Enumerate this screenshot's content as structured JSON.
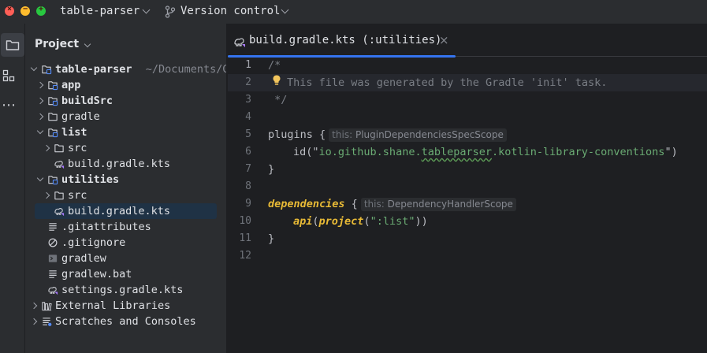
{
  "titlebar": {
    "project_name": "table-parser",
    "vcs_label": "Version control",
    "traffic_lights": {
      "close": "×",
      "minimize": "−",
      "maximize": "+"
    }
  },
  "toolstrip": {
    "items": [
      {
        "name": "project-tool-icon",
        "active": true
      },
      {
        "name": "structure-tool-icon",
        "active": false
      },
      {
        "name": "more-tools-icon",
        "active": false
      }
    ],
    "more_label": "⋯"
  },
  "project_panel": {
    "title": "Project",
    "tree": [
      {
        "label": "table-parser",
        "hint": "~/Documents/G",
        "depth": 0,
        "expanded": true,
        "icon": "module-folder",
        "bold": true
      },
      {
        "label": "app",
        "depth": 1,
        "expanded": false,
        "icon": "module-folder",
        "bold": true
      },
      {
        "label": "buildSrc",
        "depth": 1,
        "expanded": false,
        "icon": "module-folder",
        "bold": true
      },
      {
        "label": "gradle",
        "depth": 1,
        "expanded": false,
        "icon": "folder",
        "bold": false
      },
      {
        "label": "list",
        "depth": 1,
        "expanded": true,
        "icon": "module-folder",
        "bold": true
      },
      {
        "label": "src",
        "depth": 2,
        "expanded": false,
        "icon": "folder",
        "bold": false
      },
      {
        "label": "build.gradle.kts",
        "depth": 2,
        "icon": "gradle-kts",
        "bold": false
      },
      {
        "label": "utilities",
        "depth": 1,
        "expanded": true,
        "icon": "module-folder",
        "bold": true
      },
      {
        "label": "src",
        "depth": 2,
        "expanded": false,
        "icon": "folder",
        "bold": false
      },
      {
        "label": "build.gradle.kts",
        "depth": 2,
        "icon": "gradle-kts",
        "bold": false,
        "selected": true
      },
      {
        "label": ".gitattributes",
        "depth": 1,
        "icon": "text-file",
        "bold": false
      },
      {
        "label": ".gitignore",
        "depth": 1,
        "icon": "ignore-file",
        "bold": false
      },
      {
        "label": "gradlew",
        "depth": 1,
        "icon": "shell-file",
        "bold": false
      },
      {
        "label": "gradlew.bat",
        "depth": 1,
        "icon": "text-file",
        "bold": false
      },
      {
        "label": "settings.gradle.kts",
        "depth": 1,
        "icon": "gradle-kts",
        "bold": false
      },
      {
        "label": "External Libraries",
        "depth": 0,
        "expanded": false,
        "icon": "libraries",
        "bold": false
      },
      {
        "label": "Scratches and Consoles",
        "depth": 0,
        "expanded": false,
        "icon": "scratches",
        "bold": false
      }
    ]
  },
  "editor": {
    "tab_label": "build.gradle.kts (:utilities)",
    "tab_close": "×",
    "lines": {
      "l1": {
        "num": "1",
        "text": "/*"
      },
      "l2": {
        "num": "2",
        "text": "This file was generated by the Gradle 'init' task."
      },
      "l3": {
        "num": "3",
        "text": " */"
      },
      "l4": {
        "num": "4"
      },
      "l5": {
        "num": "5",
        "kw": "plugins",
        "brace": " {",
        "hint_key": "this:",
        "hint_val": "PluginDependenciesSpecScope"
      },
      "l6": {
        "num": "6",
        "fn": "id",
        "open": "(\"",
        "str_a": "io.github.shane.",
        "str_b": "tableparser",
        "str_c": ".kotlin-library-conventions",
        "close": "\")"
      },
      "l7": {
        "num": "7",
        "text": "}"
      },
      "l8": {
        "num": "8"
      },
      "l9": {
        "num": "9",
        "kw": "dependencies",
        "brace": " {",
        "hint_key": "this:",
        "hint_val": "DependencyHandlerScope"
      },
      "l10": {
        "num": "10",
        "fn": "api",
        "p1": "(",
        "fn2": "project",
        "p2": "(",
        "str": "\":list\"",
        "p3": "))"
      },
      "l11": {
        "num": "11",
        "text": "}"
      },
      "l12": {
        "num": "12"
      }
    }
  },
  "colors": {
    "background": "#1e1f22",
    "panel": "#2b2d30",
    "accent": "#3574f0",
    "selection": "#1f3245",
    "comment": "#7a7e85",
    "string": "#6aab73",
    "function": "#56a8f5",
    "keyword_call": "#e8ba36"
  }
}
